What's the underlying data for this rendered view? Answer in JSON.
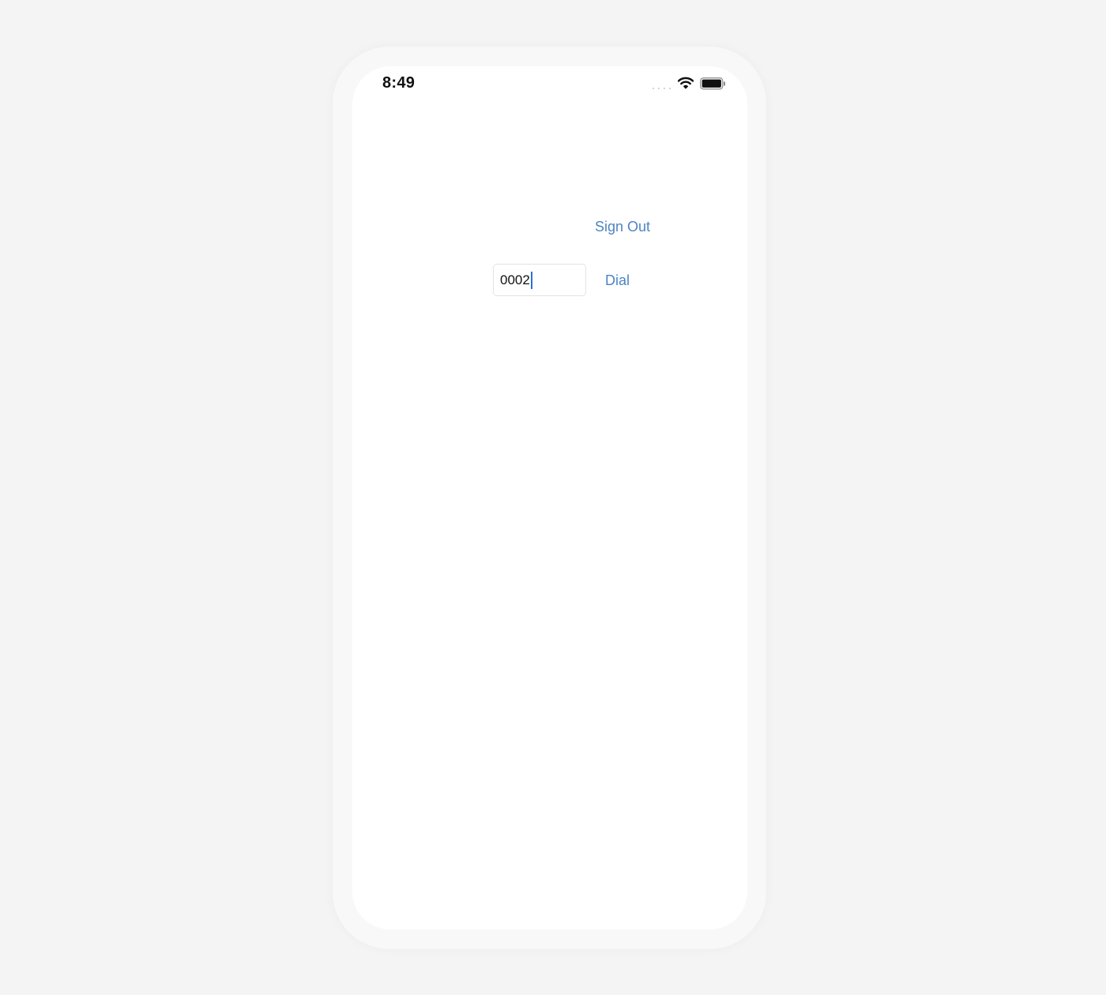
{
  "status_bar": {
    "time": "8:49",
    "icons": [
      "signal-icon",
      "wifi-icon",
      "battery-icon"
    ]
  },
  "main": {
    "sign_out_label": "Sign Out",
    "dial_input_value": "0002",
    "dial_label": "Dial"
  },
  "colors": {
    "accent": "#4e84c3",
    "background": "#f4f4f4",
    "screen": "#ffffff",
    "cursor": "#2a6fd6"
  }
}
